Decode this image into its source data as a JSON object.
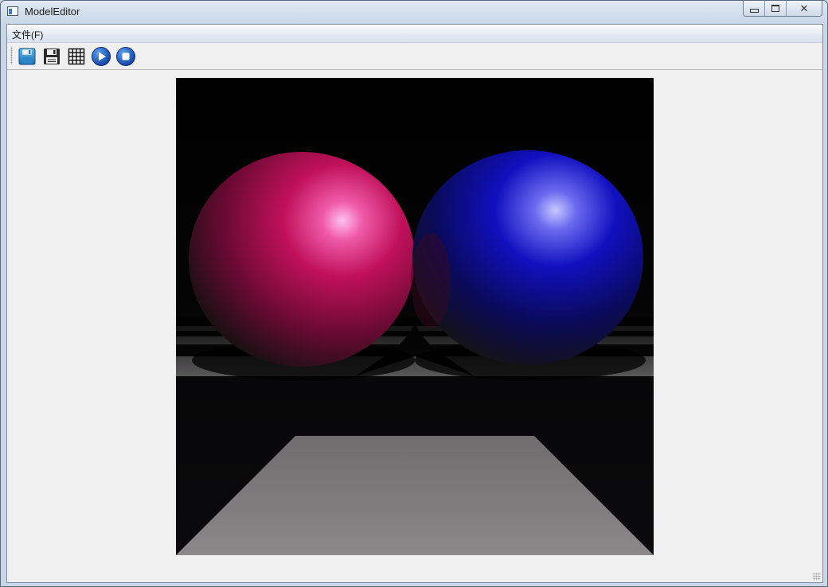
{
  "window": {
    "title": "ModelEditor",
    "app_icon": "window-app-icon",
    "caption_buttons": [
      "minimize-icon",
      "maximize-icon",
      "close-icon"
    ]
  },
  "menubar": {
    "items": [
      {
        "label": "文件(F)"
      }
    ]
  },
  "toolbar": {
    "buttons": [
      {
        "icon": "save-icon"
      },
      {
        "icon": "save-as-icon"
      },
      {
        "icon": "grid-icon"
      },
      {
        "icon": "play-icon"
      },
      {
        "icon": "stop-icon"
      }
    ]
  },
  "render": {
    "content": "raytraced scene",
    "colors": {
      "sphere_left": "#c0105a",
      "sphere_right": "#1010c0",
      "floor_light": "#8a8a8a",
      "floor_dark": "#0a0a0c",
      "background": "#000000"
    }
  }
}
